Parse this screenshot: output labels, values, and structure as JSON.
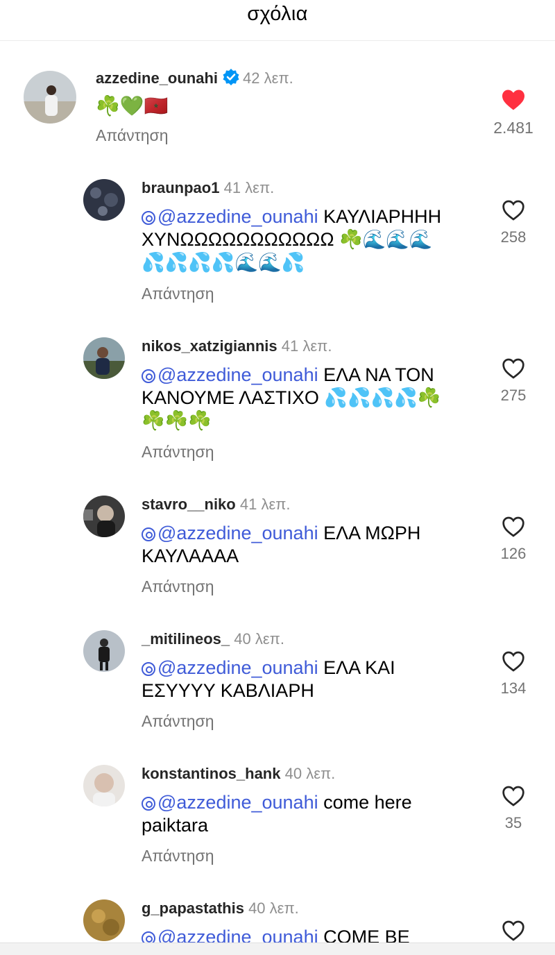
{
  "header": {
    "title": "σχόλια"
  },
  "main_comment": {
    "username": "azzedine_ounahi",
    "verified": true,
    "time": "42 λεπ.",
    "text": "☘️💚🇲🇦",
    "reply_label": "Απάντηση",
    "likes": "2.481",
    "liked": true
  },
  "replies": [
    {
      "username": "braunpao1",
      "time": "41 λεπ.",
      "mention": "@azzedine_ounahi",
      "text": " ΚΑΥΛΙΑΡΗΗΗ\nΧΥΝΩΩΩΩΩΩΩΩΩΩΩ ☘️🌊🌊🌊\n💦💦💦💦🌊🌊💦",
      "reply_label": "Απάντηση",
      "likes": "258"
    },
    {
      "username": "nikos_xatzigiannis",
      "time": "41 λεπ.",
      "mention": "@azzedine_ounahi",
      "text": " ΕΛΑ ΝΑ ΤΟΝ\nΚΑΝΟΥΜΕ ΛΑΣΤΙΧΟ 💦💦💦💦☘️\n☘️☘️☘️",
      "reply_label": "Απάντηση",
      "likes": "275"
    },
    {
      "username": "stavro__niko",
      "time": "41 λεπ.",
      "mention": "@azzedine_ounahi",
      "text": " ΕΛΑ ΜΩΡΗ\nΚΑΥΛΑΑΑΑ",
      "reply_label": "Απάντηση",
      "likes": "126"
    },
    {
      "username": "_mitilineos_",
      "time": "40 λεπ.",
      "mention": "@azzedine_ounahi",
      "text": " ΕΛΑ ΚΑΙ\nΕΣΥΥΥΥ ΚΑΒΛΙΑΡΗ",
      "reply_label": "Απάντηση",
      "likes": "134"
    },
    {
      "username": "konstantinos_hank",
      "time": "40 λεπ.",
      "mention": "@azzedine_ounahi",
      "text": " come here\npaiktara",
      "reply_label": "Απάντηση",
      "likes": "35"
    },
    {
      "username": "g_papastathis",
      "time": "40 λεπ.",
      "mention": "@azzedine_ounahi",
      "text": " COME BE",
      "reply_label": "",
      "likes": ""
    }
  ],
  "colors": {
    "like_red": "#ff3040",
    "mention_blue": "#3f5bd8",
    "verified_blue": "#0095f6"
  },
  "icons": {
    "like": "heart-icon",
    "verified": "verified-badge-icon",
    "mention": "threads-icon"
  }
}
